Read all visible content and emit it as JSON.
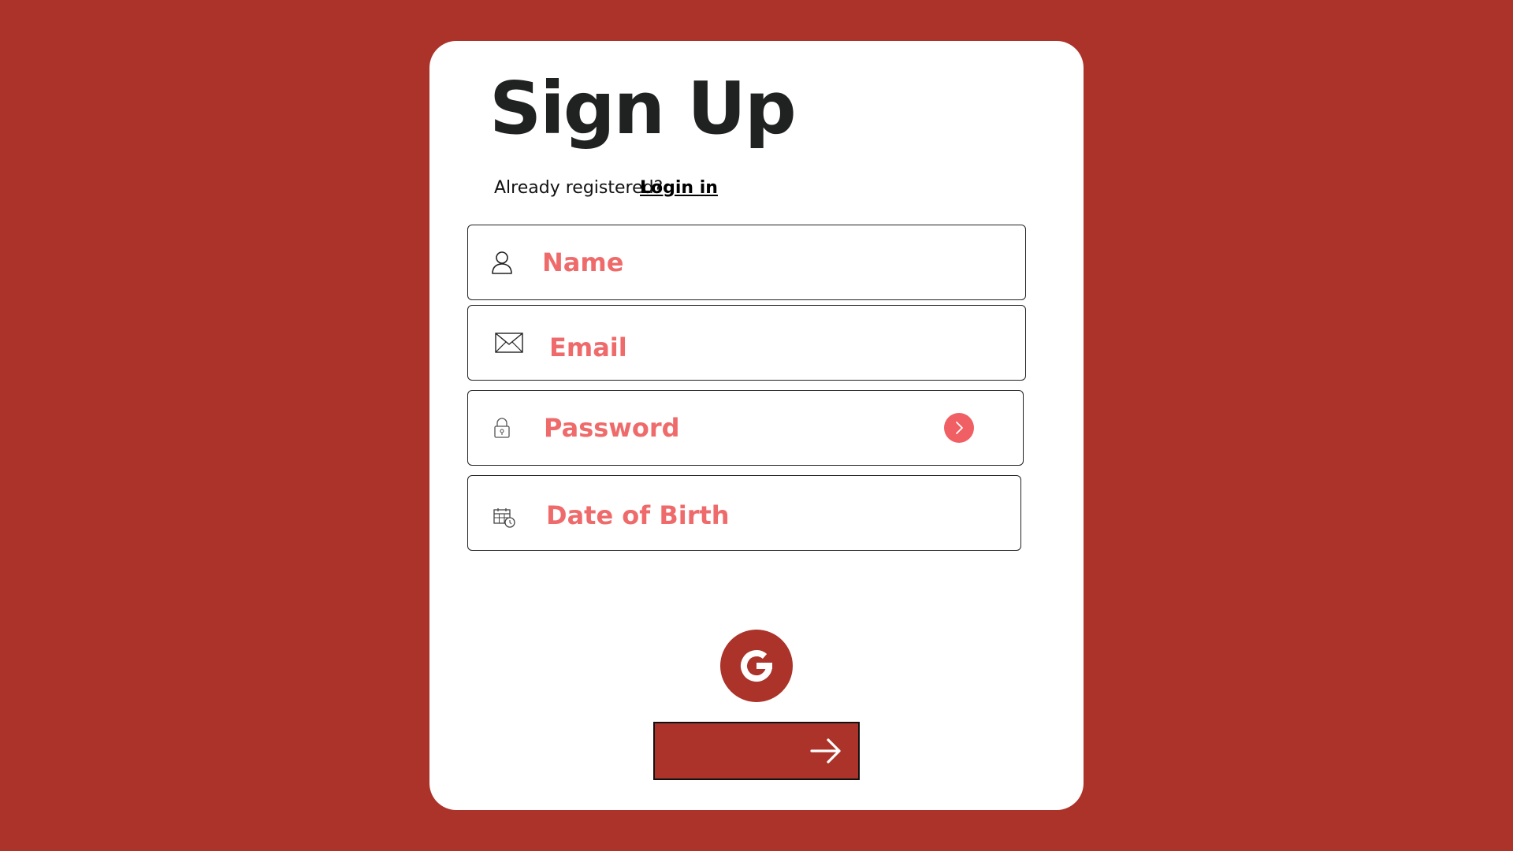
{
  "colors": {
    "background": "#ab3329",
    "card": "#ffffff",
    "title": "#1f2220",
    "placeholder": "#ef6b6b",
    "accent": "#ef5f63"
  },
  "header": {
    "title": "Sign Up",
    "subtitle": "Already registered?",
    "login_link": "Login in"
  },
  "form": {
    "name": {
      "placeholder": "Name",
      "value": "",
      "icon": "user-icon"
    },
    "email": {
      "placeholder": "Email",
      "value": "",
      "icon": "mail-icon"
    },
    "password": {
      "placeholder": "Password",
      "value": "",
      "icon": "lock-icon",
      "action_icon": "chevron-right-icon"
    },
    "dob": {
      "placeholder": "Date of Birth",
      "value": "",
      "icon": "calendar-clock-icon"
    }
  },
  "actions": {
    "google_icon": "google-icon",
    "submit_icon": "arrow-right-icon"
  }
}
